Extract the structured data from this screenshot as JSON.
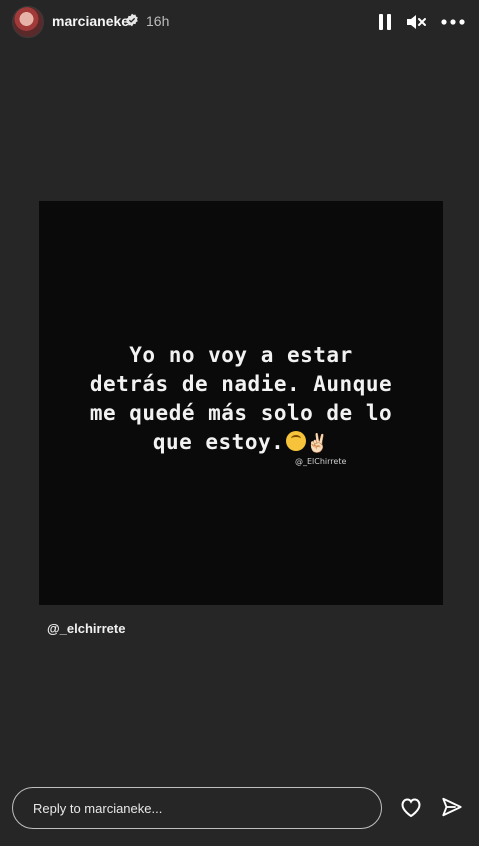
{
  "header": {
    "username": "marcianeke",
    "time": "16h",
    "icons": [
      "avatar",
      "verified-badge-icon",
      "pause-icon",
      "mute-icon",
      "more-icon"
    ]
  },
  "story": {
    "quote_lines": [
      "Yo no voy a estar",
      "detrás de nadie. Aunque",
      "me quedé más solo de lo",
      "que estoy."
    ],
    "emoji_peace": "✌🏻",
    "watermark": "@_ElChirrete",
    "mention": "@_elchirrete"
  },
  "footer": {
    "reply_placeholder": "Reply to marcianeke...",
    "icons": [
      "heart-icon",
      "send-icon"
    ]
  },
  "colors": {
    "background": "#262626",
    "card": "#0a0a0a",
    "text": "#ffffff"
  }
}
